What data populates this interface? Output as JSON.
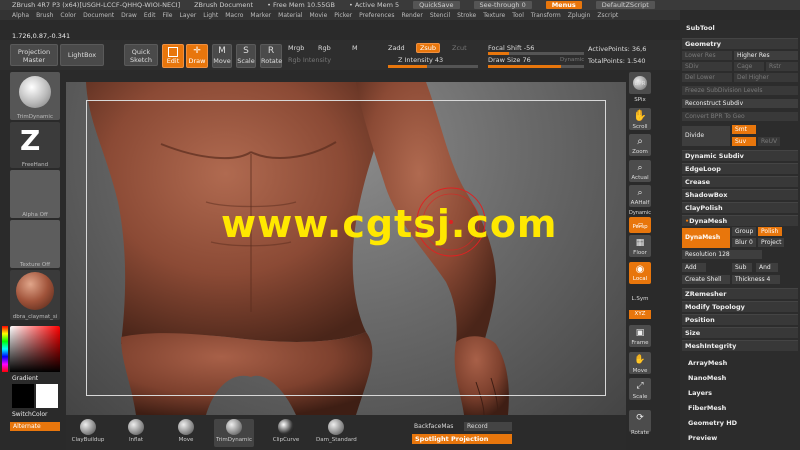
{
  "titlebar": {
    "app": "ZBrush 4R7 P3 (x64)[USGH-LCCF-QHHQ-WIOI-NECI]",
    "document": "ZBrush Document",
    "free_mem": "• Free Mem 10.55GB",
    "active_mem": "• Active Mem 5",
    "quicksave": "QuickSave",
    "see_through": "See-through  0",
    "menus": "Menus",
    "script": "DefaultZScript"
  },
  "menubar": [
    "Alpha",
    "Brush",
    "Color",
    "Document",
    "Draw",
    "Edit",
    "File",
    "Layer",
    "Light",
    "Macro",
    "Marker",
    "Material",
    "Movie",
    "Picker",
    "Preferences",
    "Render",
    "Stencil",
    "Stroke",
    "Texture",
    "Tool",
    "Transform",
    "Zplugin",
    "Zscript"
  ],
  "coords": "1.726,0.87,-0.341",
  "toolbar": {
    "projection_master": "Projection Master",
    "lightbox": "LightBox",
    "quick_sketch": "Quick Sketch",
    "edit": "Edit",
    "draw": "Draw",
    "move": "Move",
    "scale": "Scale",
    "rotate": "Rotate",
    "mrgb": "Mrgb",
    "rgb": "Rgb",
    "m": "M",
    "rgb_intensity": "Rgb Intensity",
    "zadd": "Zadd",
    "zsub": "Zsub",
    "zcut": "Zcut",
    "z_intensity": "Z Intensity 43",
    "focal_shift": "Focal Shift -56",
    "draw_size": "Draw Size 76",
    "dynamic": "Dynamic",
    "active_points": "ActivePoints: 36,6",
    "total_points": "TotalPoints: 1.540"
  },
  "sliders": {
    "z_intensity": 0.43,
    "focal_shift": 0.22,
    "draw_size": 0.76
  },
  "leftshelf": {
    "brush": "TrimDynamic",
    "stroke": "FreeHand",
    "alpha": "Alpha Off",
    "texture": "Texture Off",
    "material": "dbra_claymat_si",
    "gradient": "Gradient",
    "switch_color": "SwitchColor",
    "alternate": "Alternate"
  },
  "watermark": "www.cgtsj.com",
  "rightshelf": [
    "BPR",
    "SPix",
    "Scroll",
    "Zoom",
    "Actual",
    "AAHalf",
    "Dynamic",
    "Persp",
    "Floor",
    "Local",
    "L.Sym",
    "XYZ",
    "Frame",
    "Move",
    "Scale",
    "Rotate"
  ],
  "rightpanel": {
    "subtool": "SubTool",
    "geometry": "Geometry",
    "lower_res": "Lower Res",
    "higher_res": "Higher Res",
    "sdiv": "SDiv",
    "cage": "Cage",
    "rstr": "Rstr",
    "del_lower": "Del Lower",
    "del_higher": "Del Higher",
    "freeze": "Freeze SubDivision Levels",
    "reconstruct": "Reconstruct Subdiv",
    "convert_bpr": "Convert BPR To Geo",
    "divide": "Divide",
    "smt": "Smt",
    "suv": "Suv",
    "reuv": "ReUV",
    "dynamic_subdiv": "Dynamic Subdiv",
    "edgeloop": "EdgeLoop",
    "crease": "Crease",
    "shadowbox": "ShadowBox",
    "claypolish": "ClayPolish",
    "dynamesh_head": "DynaMesh",
    "dynamesh_btn": "DynaMesh",
    "group": "Group",
    "polish": "Polish",
    "blur": "Blur 0",
    "project": "Project",
    "resolution": "Resolution 128",
    "add": "Add",
    "sub": "Sub",
    "and": "And",
    "create_shell": "Create Shell",
    "thickness": "Thickness 4",
    "zremesher": "ZRemesher",
    "modify_topology": "Modify Topology",
    "position": "Position",
    "size": "Size",
    "meshintegrity": "MeshIntegrity",
    "arraymesh": "ArrayMesh",
    "nanomesh": "NanoMesh",
    "layers": "Layers",
    "fibermesh": "FiberMesh",
    "geometry_hd": "Geometry HD",
    "preview": "Preview"
  },
  "bottomshelf": {
    "brushes": [
      "ClayBuildup",
      "Inflat",
      "Move",
      "TrimDynamic",
      "ClipCurve",
      "Dam_Standard"
    ],
    "backface": "BackfaceMas",
    "record": "Record",
    "spotlight": "Spotlight Projection"
  },
  "colors": {
    "accent": "#e8760c",
    "watermark": "#ffe800",
    "skin": "#8b4a35"
  }
}
